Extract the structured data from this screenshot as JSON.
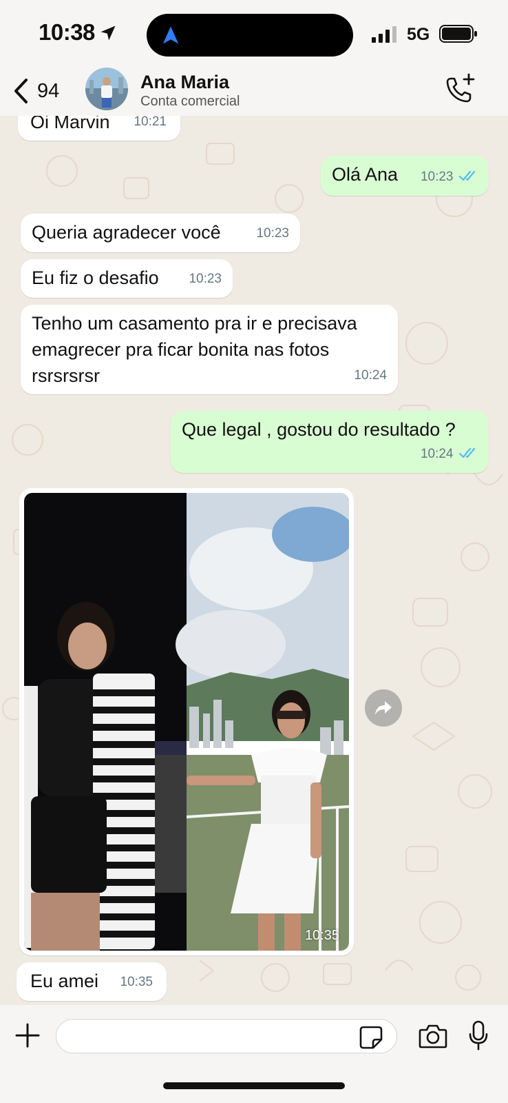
{
  "status_bar": {
    "time": "10:38",
    "network": "5G",
    "icons": [
      "location-arrow-icon",
      "dynamic-island-nav-icon",
      "signal-icon",
      "battery-icon"
    ]
  },
  "header": {
    "back_count": "94",
    "contact_name": "Ana Maria",
    "contact_subtitle": "Conta comercial",
    "icons": [
      "back-chevron-icon",
      "add-call-icon"
    ]
  },
  "messages": [
    {
      "direction": "in",
      "text": "Oi Marvin",
      "time": "10:21"
    },
    {
      "direction": "out",
      "text": "Olá Ana",
      "time": "10:23",
      "status": "read"
    },
    {
      "direction": "in",
      "text": "Queria agradecer você",
      "time": "10:23"
    },
    {
      "direction": "in",
      "text": "Eu fiz o desafio",
      "time": "10:23"
    },
    {
      "direction": "in",
      "text": "Tenho um casamento pra ir e precisava emagrecer pra ficar bonita nas fotos rsrsrsrsr",
      "time": "10:24"
    },
    {
      "direction": "out",
      "text": "Que legal , gostou do resultado ?",
      "time": "10:24",
      "status": "read"
    },
    {
      "direction": "in",
      "type": "image",
      "time": "10:35"
    },
    {
      "direction": "in",
      "text": "Eu amei",
      "time": "10:35"
    }
  ],
  "input_bar": {
    "placeholder": "",
    "icons": [
      "plus-icon",
      "sticker-icon",
      "camera-icon",
      "microphone-icon"
    ]
  },
  "colors": {
    "wallpaper": "#efeae2",
    "incoming_bubble": "#ffffff",
    "outgoing_bubble": "#d9fdd3",
    "read_ticks": "#53bdeb",
    "timestamp": "#667781"
  }
}
